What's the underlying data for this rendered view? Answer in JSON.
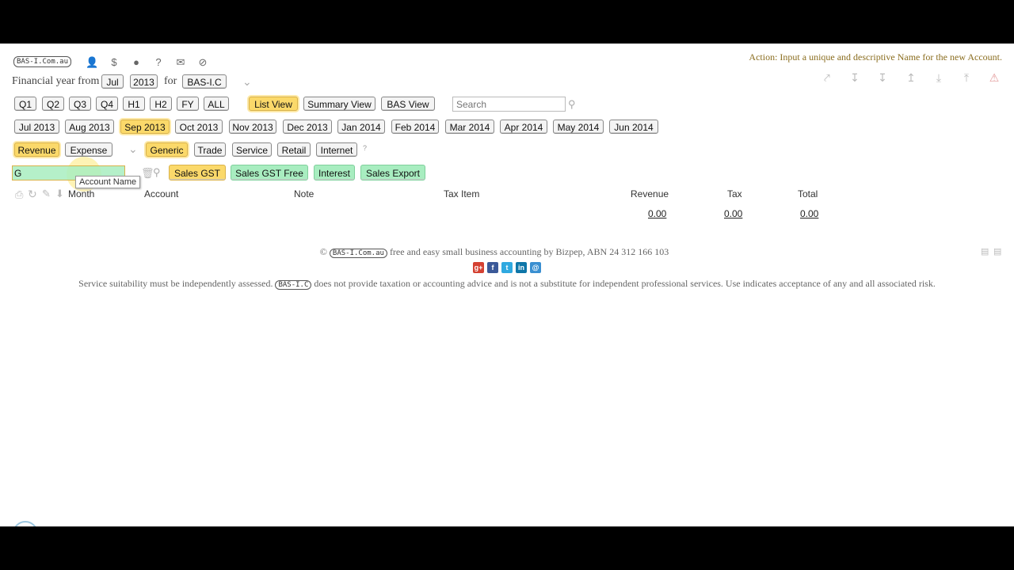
{
  "header": {
    "logo_text": "BAS-I.Com.au",
    "action_message": "Action: Input a unique and descriptive Name for the new Account.",
    "fy_label": "Financial year from",
    "fy_month": "Jul",
    "fy_year": "2013",
    "for_label": "for",
    "entity": "BAS-I.C"
  },
  "top_icons": [
    "user-icon",
    "dollar-icon",
    "person-icon",
    "help-icon",
    "mail-icon",
    "hide-icon"
  ],
  "right_icons": [
    "share-icon",
    "download-icon",
    "download-alt-icon",
    "upload-icon",
    "export-icon",
    "upload-alt-icon",
    "warning-icon"
  ],
  "periods": [
    "Q1",
    "Q2",
    "Q3",
    "Q4",
    "H1",
    "H2",
    "FY",
    "ALL"
  ],
  "views": {
    "list": "List View",
    "summary": "Summary View",
    "bas": "BAS View"
  },
  "search": {
    "placeholder": "Search"
  },
  "months": [
    "Jul 2013",
    "Aug 2013",
    "Sep 2013",
    "Oct 2013",
    "Nov 2013",
    "Dec 2013",
    "Jan 2014",
    "Feb 2014",
    "Mar 2014",
    "Apr 2014",
    "May 2014",
    "Jun 2014"
  ],
  "types": {
    "revenue": "Revenue",
    "expense": "Expense"
  },
  "categories": [
    "Generic",
    "Trade",
    "Service",
    "Retail",
    "Internet"
  ],
  "help_mark": "?",
  "account_input": {
    "value": "G",
    "tooltip": "Account Name"
  },
  "accounts": [
    "Sales GST",
    "Sales GST Free",
    "Interest",
    "Sales Export"
  ],
  "table": {
    "headers": [
      "Month",
      "Account",
      "Note",
      "Tax Item",
      "Revenue",
      "Tax",
      "Total"
    ],
    "totals": {
      "revenue": "0.00",
      "tax": "0.00",
      "total": "0.00"
    }
  },
  "footer": {
    "copyright": "©",
    "logo_text": "BAS-I.Com.au",
    "tagline": "free and easy small business accounting by Bizpep, ABN 24 312 166 103",
    "disclaimer_1": "Service suitability must be independently assessed.",
    "disclaimer_badge": "BAS-I.C",
    "disclaimer_2": "does not provide taxation or accounting advice and is not a substitute for independent professional services. Use indicates acceptance of any and all associated risk.",
    "social": [
      "g+",
      "f",
      "t",
      "in",
      "@"
    ]
  },
  "colors": {
    "selected": "#fbd96a",
    "account_green": "#a8edc0",
    "action_text": "#8a6d1f"
  }
}
